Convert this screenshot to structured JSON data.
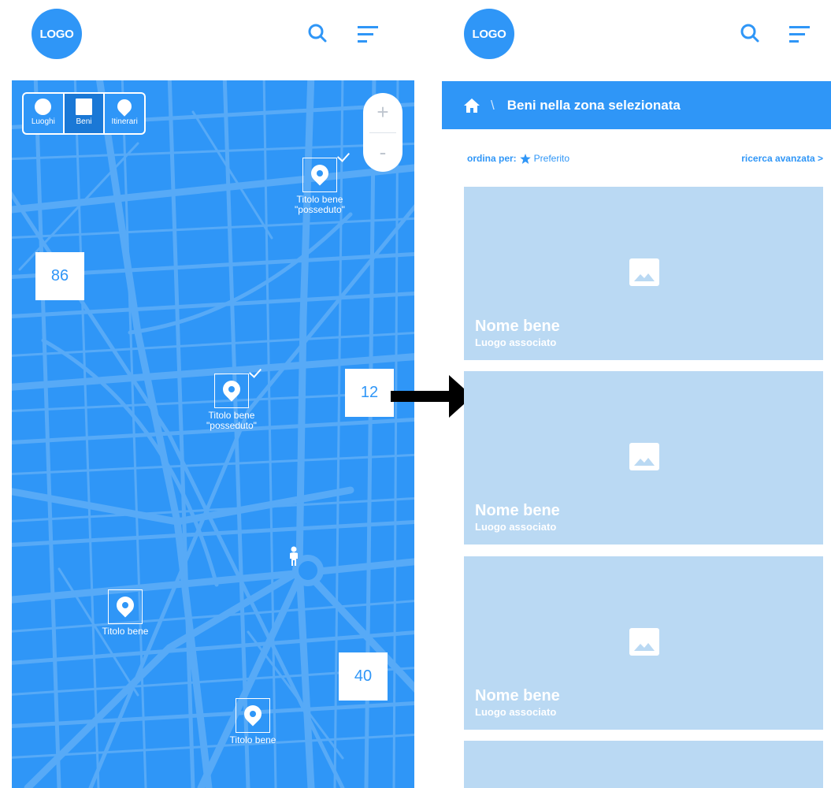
{
  "colors": {
    "accent": "#2f96f7",
    "card_bg": "#bad9f3",
    "street": "#57aaf7"
  },
  "left": {
    "logo": "LOGO",
    "header_icons": [
      "search-icon",
      "menu-icon"
    ],
    "filters": [
      {
        "label": "Luoghi",
        "icon": "circle-icon",
        "active": false
      },
      {
        "label": "Beni",
        "icon": "square-icon",
        "active": true
      },
      {
        "label": "Itinerari",
        "icon": "pin-icon",
        "active": false
      }
    ],
    "zoom": {
      "in": "+",
      "out": "-"
    },
    "clusters": [
      "86",
      "12",
      "40"
    ],
    "markers": [
      {
        "label1": "Titolo bene",
        "label2": "\"posseduto\"",
        "owned": true
      },
      {
        "label1": "Titolo bene",
        "label2": "\"posseduto\"",
        "owned": true
      },
      {
        "label1": "Titolo bene",
        "label2": "",
        "owned": false
      },
      {
        "label1": "Titolo bene",
        "label2": "",
        "owned": false
      }
    ]
  },
  "right": {
    "logo": "LOGO",
    "header_icons": [
      "search-icon",
      "menu-icon"
    ],
    "titlebar": {
      "title": "Beni nella zona selezionata",
      "separator": "\\"
    },
    "sort": {
      "label": "ordina per:",
      "value": "Preferito",
      "advanced": "ricerca avanzata >"
    },
    "cards": [
      {
        "name": "Nome bene",
        "place": "Luogo associato"
      },
      {
        "name": "Nome bene",
        "place": "Luogo associato"
      },
      {
        "name": "Nome bene",
        "place": "Luogo associato"
      },
      {
        "name": "",
        "place": ""
      }
    ]
  }
}
